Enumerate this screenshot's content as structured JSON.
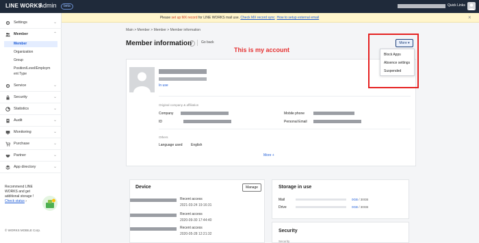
{
  "topbar": {
    "brand": "LINE WORKS",
    "admin": "Admin",
    "badge": "beta",
    "quick_links": "Quick Links"
  },
  "notice": {
    "prefix": "Please ",
    "link1": "set up MX record",
    "middle": " for LINE WORKS mail use. ",
    "link2": "Check MX record sync",
    "link3": "How to setup external email"
  },
  "sidebar": {
    "items": [
      {
        "label": "Settings",
        "icon": "gear-icon"
      },
      {
        "label": "Member",
        "icon": "people-icon"
      },
      {
        "label": "Service",
        "icon": "gear-icon"
      },
      {
        "label": "Security",
        "icon": "lock-icon"
      },
      {
        "label": "Statistics",
        "icon": "chart-icon"
      },
      {
        "label": "Audit",
        "icon": "document-icon"
      },
      {
        "label": "Monitoring",
        "icon": "monitor-icon"
      },
      {
        "label": "Purchase",
        "icon": "cart-icon"
      },
      {
        "label": "Partner",
        "icon": "handshake-icon"
      },
      {
        "label": "App directory",
        "icon": "app-icon"
      }
    ],
    "member_sub": [
      "Member",
      "Organization",
      "Group",
      "Position/Level/Employm",
      "ent Type"
    ],
    "promo": {
      "line1": "Recommend LINE",
      "line2": "WORKS and get",
      "line3": "additional storage !",
      "link": "Check status"
    },
    "copyright": "© WORKS MOBILE Corp."
  },
  "breadcrumb": "Main  >  Member  >  Member  >  Member information",
  "page": {
    "title": "Member information",
    "go_back": "Go back",
    "annotation": "This is my account"
  },
  "more_menu": {
    "button": "More",
    "items": [
      "Block Apps",
      "Absence settings",
      "Suspended"
    ]
  },
  "member": {
    "status": "In use",
    "section1": "Original company & affiliation",
    "labels": {
      "company": "Company",
      "id": "ID",
      "mobile": "Mobile phone",
      "email": "Personal Email"
    },
    "section2": "Others",
    "language_label": "Language used",
    "language_value": "English",
    "more_link": "More +"
  },
  "device": {
    "title": "Device",
    "manage": "Manage",
    "accesses": [
      {
        "label": "Recent access",
        "date": "2021-03-24 19:16:31"
      },
      {
        "label": "Recent access",
        "date": "2020-09-30 17:44:40"
      },
      {
        "label": "Recent access",
        "date": "2020-05-28 12:21:32"
      }
    ]
  },
  "storage": {
    "title": "Storage in use",
    "rows": [
      {
        "label": "Mail",
        "used": "0GB",
        "total": " / 30GB",
        "fraction": 0
      },
      {
        "label": "Drive",
        "used": "0GB",
        "total": " / 30GB",
        "fraction": 0
      }
    ]
  },
  "security": {
    "title": "Security",
    "sub": "Security"
  }
}
